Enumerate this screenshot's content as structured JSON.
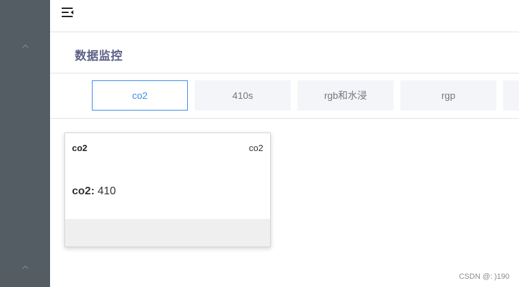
{
  "header": {
    "menu_icon": "menu-fold-icon"
  },
  "page": {
    "title": "数据监控"
  },
  "tabs": [
    {
      "label": "co2",
      "active": true
    },
    {
      "label": "410s",
      "active": false
    },
    {
      "label": "rgb和水浸",
      "active": false
    },
    {
      "label": "rgp",
      "active": false
    }
  ],
  "card": {
    "name": "co2",
    "tag": "co2",
    "reading_key": "co2",
    "reading_sep": ":",
    "reading_value": "410"
  },
  "sidebar": {
    "icons": [
      "chevron-up-icon",
      "chevron-up-icon"
    ]
  },
  "watermark": "CSDN @: )190",
  "colors": {
    "sidebar": "#545c64",
    "accent": "#3a8ee6",
    "title": "#5c6187",
    "tab_bg": "#f4f5f9"
  }
}
